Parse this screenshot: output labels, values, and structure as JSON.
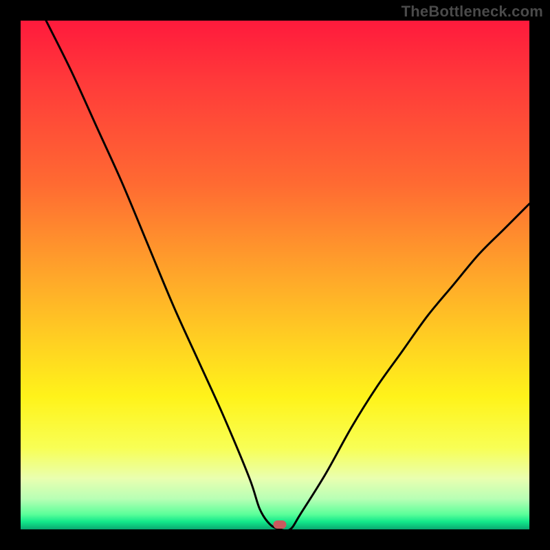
{
  "watermark": "TheBottleneck.com",
  "chart_data": {
    "type": "line",
    "title": "",
    "xlabel": "",
    "ylabel": "",
    "xlim": [
      0,
      100
    ],
    "ylim": [
      0,
      100
    ],
    "series": [
      {
        "name": "bottleneck-curve",
        "x": [
          5,
          10,
          15,
          20,
          25,
          30,
          35,
          40,
          45,
          47,
          49,
          51,
          53,
          55,
          60,
          65,
          70,
          75,
          80,
          85,
          90,
          95,
          100
        ],
        "y": [
          100,
          90,
          79,
          68,
          56,
          44,
          33,
          22,
          10,
          4,
          1,
          0,
          0,
          3,
          11,
          20,
          28,
          35,
          42,
          48,
          54,
          59,
          64
        ]
      }
    ],
    "marker": {
      "x_percent": 51,
      "label": "optimal-point"
    },
    "background_gradient": {
      "stops": [
        {
          "pos": 0.0,
          "color": "#ff1a3c"
        },
        {
          "pos": 0.12,
          "color": "#ff3a3a"
        },
        {
          "pos": 0.32,
          "color": "#ff6a32"
        },
        {
          "pos": 0.5,
          "color": "#ffa62a"
        },
        {
          "pos": 0.63,
          "color": "#ffd022"
        },
        {
          "pos": 0.74,
          "color": "#fff31a"
        },
        {
          "pos": 0.84,
          "color": "#f8ff55"
        },
        {
          "pos": 0.9,
          "color": "#e9ffb0"
        },
        {
          "pos": 0.94,
          "color": "#b8ffb5"
        },
        {
          "pos": 0.97,
          "color": "#5dff9a"
        },
        {
          "pos": 0.985,
          "color": "#12e88a"
        },
        {
          "pos": 1.0,
          "color": "#0aa870"
        }
      ]
    },
    "marker_color": "#c95a5e",
    "curve_color": "#000000"
  }
}
